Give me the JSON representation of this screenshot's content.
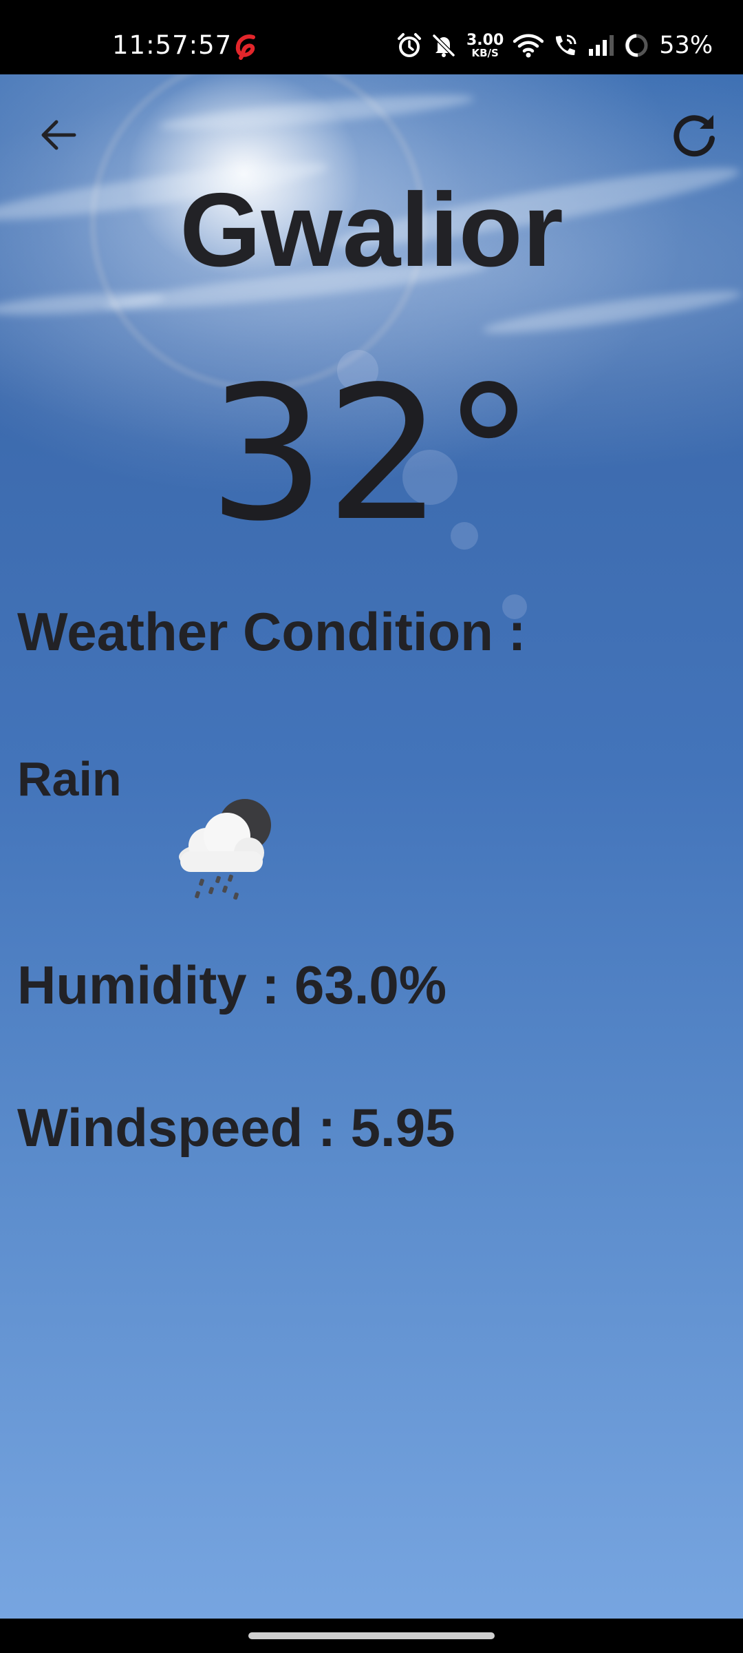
{
  "status_bar": {
    "time": "11:57:57",
    "net_speed_value": "3.00",
    "net_speed_unit": "KB/S",
    "battery": "53%",
    "icons": [
      "airtel-icon",
      "alarm-icon",
      "mute-icon",
      "wifi-icon",
      "wifi-calling-icon",
      "signal-icon",
      "battery-icon"
    ],
    "carrier_color": "#e3262b"
  },
  "header": {
    "back_icon": "arrow-left-icon",
    "refresh_icon": "refresh-icon"
  },
  "weather": {
    "city": "Gwalior",
    "temperature": "32°",
    "condition_label": "Weather Condition :",
    "condition": "Rain",
    "condition_icon": "cloud-rain-moon-icon",
    "humidity": "Humidity : 63.0%",
    "windspeed": "Windspeed : 5.95"
  },
  "colors": {
    "text": "#222226",
    "sky_top": "#3f71b4",
    "sky_bottom": "#77a5e0"
  }
}
